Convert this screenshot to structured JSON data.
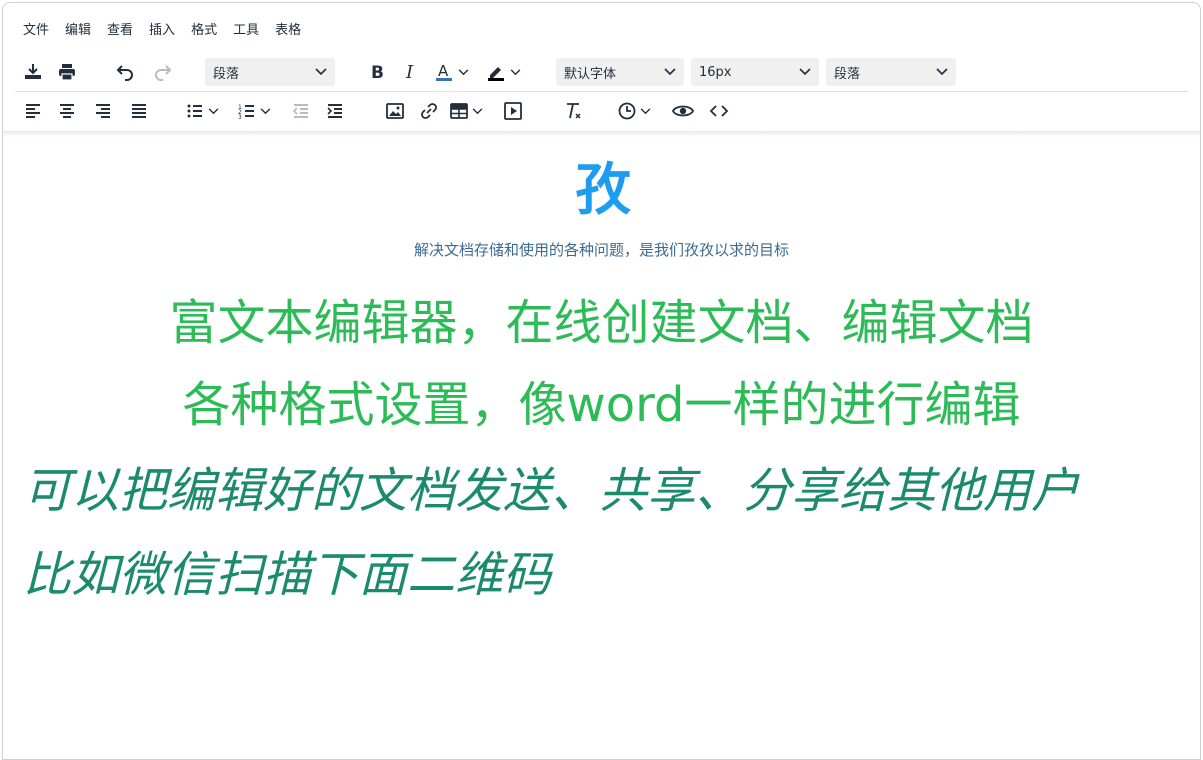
{
  "menu": [
    "文件",
    "编辑",
    "查看",
    "插入",
    "格式",
    "工具",
    "表格"
  ],
  "toolbar": {
    "block_format": "段落",
    "font_family": "默认字体",
    "font_size": "16px",
    "line_height": "段落"
  },
  "colors": {
    "font_color_bar": "#3a73b8",
    "highlight_bar": "#000000"
  },
  "icons": {
    "row1": [
      "download-icon",
      "print-icon",
      "undo-icon",
      "redo-icon",
      "bold-icon",
      "italic-icon",
      "font-color-icon",
      "highlight-icon"
    ],
    "row2": [
      "align-left-icon",
      "align-center-icon",
      "align-right-icon",
      "justify-icon",
      "bullet-list-icon",
      "numbered-list-icon",
      "outdent-icon",
      "indent-icon",
      "image-icon",
      "link-icon",
      "table-icon",
      "media-icon",
      "clear-format-icon",
      "time-icon",
      "preview-icon",
      "code-icon"
    ]
  },
  "content": {
    "logo": "孜",
    "subtitle": "解决文档存储和使用的各种问题，是我们孜孜以求的目标",
    "line1": "富文本编辑器，在线创建文档、编辑文档",
    "line2": "各种格式设置，像word一样的进行编辑",
    "line3": "可以把编辑好的文档发送、共享、分享给其他用户",
    "line4": "比如微信扫描下面二维码"
  }
}
